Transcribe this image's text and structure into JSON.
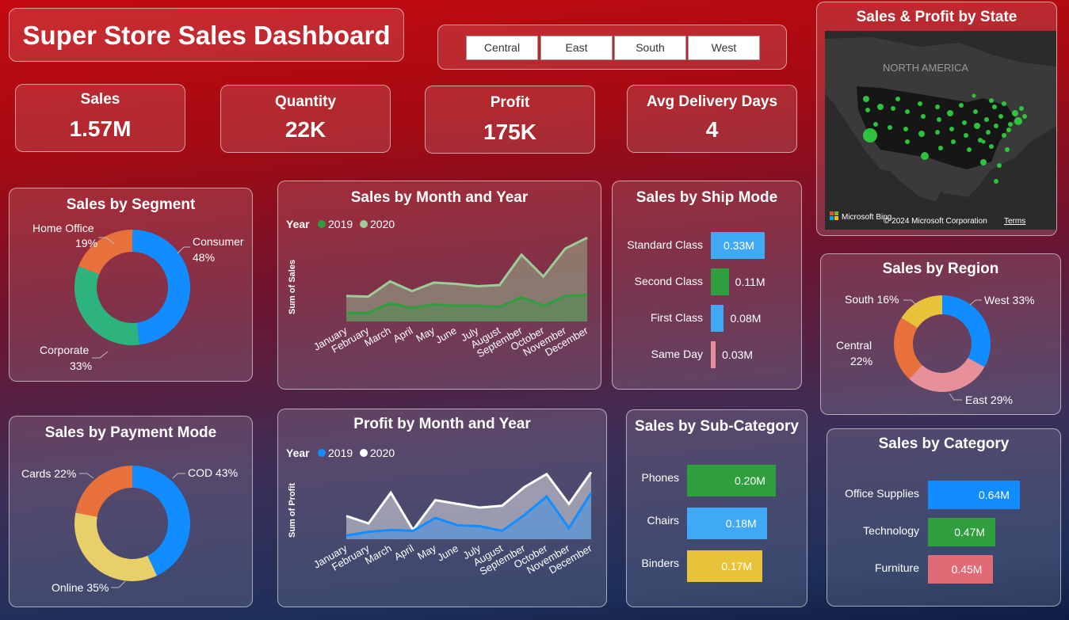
{
  "title": "Super Store Sales Dashboard",
  "regions": [
    "Central",
    "East",
    "South",
    "West"
  ],
  "kpis": {
    "sales": {
      "label": "Sales",
      "value": "1.57M"
    },
    "quantity": {
      "label": "Quantity",
      "value": "22K"
    },
    "profit": {
      "label": "Profit",
      "value": "175K"
    },
    "delivery": {
      "label": "Avg Delivery Days",
      "value": "4"
    }
  },
  "map": {
    "title": "Sales & Profit by State",
    "continent_label": "NORTH AMERICA",
    "brand": "Microsoft Bing",
    "copyright": "© 2024 Microsoft Corporation",
    "terms": "Terms"
  },
  "segment": {
    "title": "Sales by Segment",
    "slices": [
      {
        "name": "Consumer",
        "pct": "48%",
        "value": 48,
        "color": "#118DFF"
      },
      {
        "name": "Corporate",
        "pct": "33%",
        "value": 33,
        "color": "#2DB47E"
      },
      {
        "name": "Home Office",
        "pct": "19%",
        "value": 19,
        "color": "#E8703A"
      }
    ]
  },
  "payment": {
    "title": "Sales by Payment Mode",
    "slices": [
      {
        "name": "COD",
        "pct": "43%",
        "value": 43,
        "color": "#118DFF"
      },
      {
        "name": "Online",
        "pct": "35%",
        "value": 35,
        "color": "#E8CF6A"
      },
      {
        "name": "Cards",
        "pct": "22%",
        "value": 22,
        "color": "#E8703A"
      }
    ]
  },
  "region_chart": {
    "title": "Sales by Region",
    "slices": [
      {
        "name": "West",
        "pct": "33%",
        "value": 33,
        "color": "#118DFF"
      },
      {
        "name": "East",
        "pct": "29%",
        "value": 29,
        "color": "#E8909A"
      },
      {
        "name": "Central",
        "pct": "22%",
        "value": 22,
        "color": "#E8703A"
      },
      {
        "name": "South",
        "pct": "16%",
        "value": 16,
        "color": "#E8C33A"
      }
    ]
  },
  "month_sales": {
    "title": "Sales by Month and Year",
    "legend_title": "Year",
    "ylabel": "Sum of Sales"
  },
  "month_profit": {
    "title": "Profit by Month and Year",
    "legend_title": "Year",
    "ylabel": "Sum of Profit"
  },
  "ship_mode": {
    "title": "Sales by Ship Mode",
    "items": [
      {
        "name": "Standard Class",
        "label": "0.33M",
        "value": 0.33,
        "color": "#3FA9F5"
      },
      {
        "name": "Second Class",
        "label": "0.11M",
        "value": 0.11,
        "color": "#2E9E3E"
      },
      {
        "name": "First Class",
        "label": "0.08M",
        "value": 0.08,
        "color": "#3FA9F5"
      },
      {
        "name": "Same Day",
        "label": "0.03M",
        "value": 0.03,
        "color": "#E8909A"
      }
    ]
  },
  "sub_category": {
    "title": "Sales by Sub-Category",
    "items": [
      {
        "name": "Phones",
        "label": "0.20M",
        "value": 0.2,
        "color": "#2E9E3E"
      },
      {
        "name": "Chairs",
        "label": "0.18M",
        "value": 0.18,
        "color": "#3FA9F5"
      },
      {
        "name": "Binders",
        "label": "0.17M",
        "value": 0.17,
        "color": "#E8C33A"
      }
    ]
  },
  "category": {
    "title": "Sales by Category",
    "items": [
      {
        "name": "Office Supplies",
        "label": "0.64M",
        "value": 0.64,
        "color": "#118DFF"
      },
      {
        "name": "Technology",
        "label": "0.47M",
        "value": 0.47,
        "color": "#2E9E3E"
      },
      {
        "name": "Furniture",
        "label": "0.45M",
        "value": 0.45,
        "color": "#E06A76"
      }
    ]
  },
  "chart_data": [
    {
      "type": "area",
      "title": "Sales by Month and Year",
      "ylabel": "Sum of Sales",
      "categories": [
        "January",
        "February",
        "March",
        "April",
        "May",
        "June",
        "July",
        "August",
        "September",
        "October",
        "November",
        "December"
      ],
      "series": [
        {
          "name": "2019",
          "color": "#2E9E3E",
          "values": [
            14,
            14,
            30,
            22,
            28,
            26,
            26,
            24,
            40,
            26,
            42,
            44
          ]
        },
        {
          "name": "2020",
          "color": "#9DCC98",
          "values": [
            42,
            41,
            66,
            50,
            64,
            62,
            58,
            60,
            110,
            74,
            120,
            138
          ]
        }
      ],
      "ylim": [
        0,
        150
      ]
    },
    {
      "type": "area",
      "title": "Profit by Month and Year",
      "ylabel": "Sum of Profit",
      "categories": [
        "January",
        "February",
        "March",
        "April",
        "May",
        "June",
        "July",
        "August",
        "September",
        "October",
        "November",
        "December"
      ],
      "series": [
        {
          "name": "2019",
          "color": "#118DFF",
          "values": [
            4,
            8,
            10,
            9,
            23,
            15,
            14,
            9,
            26,
            46,
            12,
            50
          ]
        },
        {
          "name": "2020",
          "color": "#FFFFFF",
          "values": [
            25,
            17,
            50,
            10,
            42,
            38,
            34,
            36,
            56,
            70,
            38,
            72
          ]
        }
      ],
      "ylim": [
        0,
        80
      ]
    }
  ]
}
